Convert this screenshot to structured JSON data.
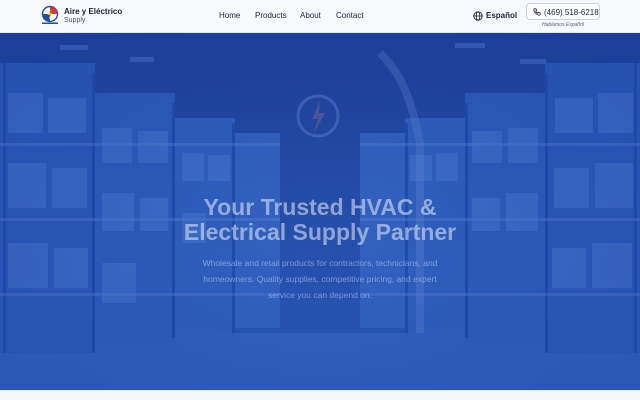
{
  "brand": {
    "name": "Aire y Eléctrico",
    "subtitle": "Supply"
  },
  "nav": {
    "items": [
      {
        "label": "Home"
      },
      {
        "label": "Products"
      },
      {
        "label": "About"
      },
      {
        "label": "Contact"
      }
    ]
  },
  "language": {
    "icon": "globe-icon",
    "label": "Español"
  },
  "phone": {
    "icon": "phone-icon",
    "number": "(469) 518-6218",
    "note": "Hablamos Español"
  },
  "hero": {
    "title_line1": "Your Trusted HVAC &",
    "title_line2": "Electrical Supply Partner",
    "subtitle": "Wholesale and retail products for contractors, technicians, and homeowners. Quality supplies, competitive pricing, and expert service you can depend on."
  },
  "colors": {
    "hero_blue": "#2b58b8",
    "header_bg": "#f7f9fc",
    "text_dark": "#1b2233"
  }
}
